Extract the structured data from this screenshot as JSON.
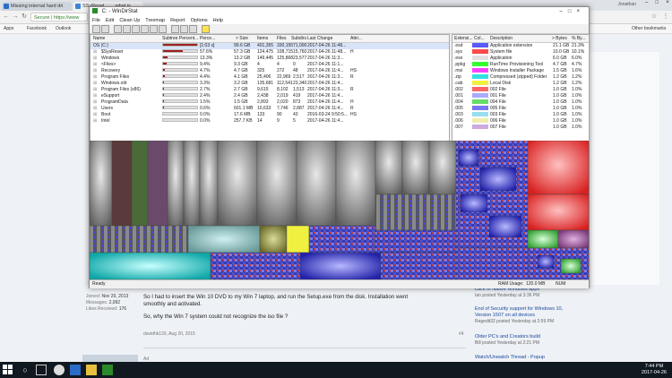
{
  "browser": {
    "tabs": [
      {
        "label": "Missing internal hard dri",
        "color": "#2b6cc8",
        "active": false
      },
      {
        "label": "SSyReset........what is",
        "color": "#3a86d8",
        "active": true
      },
      {
        "label": "",
        "color": "#cfd5dc",
        "active": false
      }
    ],
    "account_label": "Jonathan",
    "address": "Secure | https://www",
    "bookmarks": [
      "Apps",
      "Facebook",
      "Outlook"
    ],
    "other_bookmarks": "Other bookmarks"
  },
  "wds": {
    "title": "C: - WinDirStat",
    "menu": [
      "File",
      "Edit",
      "Clean Up",
      "Treemap",
      "Report",
      "Options",
      "Help"
    ],
    "columns": [
      "Name",
      "Subtree Percent...",
      "Perce...",
      "> Size",
      "Items",
      "Files",
      "Subdirs",
      "Last Change",
      "Attri..."
    ],
    "rows": [
      {
        "name": "OS (C:)",
        "pct": "[1:03 s]",
        "size": "99.6 GB",
        "items": "401,355",
        "files": "330,155",
        "subdirs": "71,000",
        "changed": "2017-04-26 11:48...",
        "attr": "",
        "fill": 0.99,
        "sel": true
      },
      {
        "name": "$SysReset",
        "pct": "57.6%",
        "size": "57.3 GB",
        "items": "124,475",
        "files": "108,715",
        "subdirs": "15,760",
        "changed": "2017-04-26 11:48...",
        "attr": "H",
        "fill": 0.576
      },
      {
        "name": "Windows",
        "pct": "13.3%",
        "size": "13.2 GB",
        "items": "149,445",
        "files": "125,868",
        "subdirs": "23,577",
        "changed": "2017-04-26 11:3...",
        "attr": "",
        "fill": 0.133
      },
      {
        "name": "<Files>",
        "pct": "9.4%",
        "size": "9.3 GB",
        "items": "4",
        "files": "4",
        "subdirs": "0",
        "changed": "2017-04-26 11:1...",
        "attr": "",
        "fill": 0.094
      },
      {
        "name": "Recovery",
        "pct": "4.7%",
        "size": "4.7 GB",
        "items": "325",
        "files": "272",
        "subdirs": "48",
        "changed": "2017-04-26 11:4...",
        "attr": "HS",
        "fill": 0.047
      },
      {
        "name": "Program Files",
        "pct": "4.4%",
        "size": "4.1 GB",
        "items": "25,406",
        "files": "22,969",
        "subdirs": "2,517",
        "changed": "2017-04-26 11:3...",
        "attr": "R",
        "fill": 0.044
      },
      {
        "name": "Windows.old",
        "pct": "3.3%",
        "size": "3.2 GB",
        "items": "135,681",
        "files": "112,541",
        "subdirs": "23,340",
        "changed": "2017-04-26 11:4...",
        "attr": "",
        "fill": 0.033
      },
      {
        "name": "Program Files (x86)",
        "pct": "2.7%",
        "size": "2.7 GB",
        "items": "9,615",
        "files": "8,102",
        "subdirs": "1,513",
        "changed": "2017-04-26 11:3...",
        "attr": "R",
        "fill": 0.027
      },
      {
        "name": "eSupport",
        "pct": "2.4%",
        "size": "2.4 GB",
        "items": "2,438",
        "files": "2,019",
        "subdirs": "419",
        "changed": "2017-04-26 11:4...",
        "attr": "",
        "fill": 0.024
      },
      {
        "name": "ProgramData",
        "pct": "1.5%",
        "size": "1.5 GB",
        "items": "2,893",
        "files": "2,020",
        "subdirs": "873",
        "changed": "2017-04-26 11:4...",
        "attr": "H",
        "fill": 0.015
      },
      {
        "name": "Users",
        "pct": "0.6%",
        "size": "601.1 MB",
        "items": "10,633",
        "files": "7,746",
        "subdirs": "2,887",
        "changed": "2017-04-26 11:4...",
        "attr": "R",
        "fill": 0.006
      },
      {
        "name": "Boot",
        "pct": "0.0%",
        "size": "17.6 MB",
        "items": "133",
        "files": "90",
        "subdirs": "43",
        "changed": "2016-03-24 9:50:5...",
        "attr": "HS",
        "fill": 0.0
      },
      {
        "name": "Intel",
        "pct": "0.0%",
        "size": "257.7 KB",
        "items": "14",
        "files": "9",
        "subdirs": "5",
        "changed": "2017-04-26 11:4...",
        "attr": "",
        "fill": 0.0
      }
    ],
    "ext_columns": [
      "Extensi...",
      "Col...",
      "Description",
      "> Bytes",
      "% By..."
    ],
    "extensions": [
      {
        "ext": ".esd",
        "color": "#5a5aff",
        "desc": "Application extension",
        "bytes": "21.1 GB",
        "pct": "21.3%"
      },
      {
        "ext": ".sys",
        "color": "#ff4a4a",
        "desc": "System file",
        "bytes": "10.0 GB",
        "pct": "10.1%"
      },
      {
        "ext": ".exe",
        "color": "#e0e0e0",
        "desc": "Application",
        "bytes": "6.0 GB",
        "pct": "6.0%"
      },
      {
        "ext": ".ppkg",
        "color": "#33ff33",
        "desc": "RunTime Provisioning Tool",
        "bytes": "4.7 GB",
        "pct": "4.7%"
      },
      {
        "ext": ".msi",
        "color": "#ff44ff",
        "desc": "Windows Installer Package",
        "bytes": "1.5 GB",
        "pct": "1.6%"
      },
      {
        "ext": ".zip",
        "color": "#33e0e0",
        "desc": "Compressed (zipped) Folder",
        "bytes": "1.2 GB",
        "pct": "1.2%"
      },
      {
        "ext": ".cab",
        "color": "#f0f040",
        "desc": "Local Disk",
        "bytes": "1.2 GB",
        "pct": "1.2%"
      },
      {
        "ext": ".002",
        "color": "#ff6666",
        "desc": "002 File",
        "bytes": "1.0 GB",
        "pct": "1.0%"
      },
      {
        "ext": ".001",
        "color": "#aaaaff",
        "desc": "001 File",
        "bytes": "1.0 GB",
        "pct": "1.0%"
      },
      {
        "ext": ".004",
        "color": "#66dd66",
        "desc": "004 File",
        "bytes": "1.0 GB",
        "pct": "1.0%"
      },
      {
        "ext": ".005",
        "color": "#7777ee",
        "desc": "005 File",
        "bytes": "1.0 GB",
        "pct": "1.0%"
      },
      {
        "ext": ".003",
        "color": "#99ddee",
        "desc": "003 File",
        "bytes": "1.0 GB",
        "pct": "1.0%"
      },
      {
        "ext": ".006",
        "color": "#eeeeaa",
        "desc": "006 File",
        "bytes": "1.0 GB",
        "pct": "1.0%"
      },
      {
        "ext": ".007",
        "color": "#ccaadd",
        "desc": "007 File",
        "bytes": "1.0 GB",
        "pct": "1.0%"
      }
    ],
    "status_left": "Ready",
    "status_ram": "RAM Usage:",
    "status_ram_value": "120.0 MB",
    "status_num": "NUM"
  },
  "post": {
    "joined_label": "Joined:",
    "joined": "Nov 20, 2013",
    "messages_label": "Messages:",
    "messages": "2,092",
    "likes_label": "Likes Received:",
    "likes": "176",
    "line1": "So I had to insert the Win 10 DVD to my Win 7 laptop, and run the Setup.exe from the disk. Installation went",
    "line2": "smoothly and activated.",
    "line3": "So, why the Win 7 system could not recognize the iso file ?",
    "author_date": "davidhk129, Aug 20, 2015",
    "post_num": "#4",
    "ad_label": "Ad"
  },
  "sidebar": [
    {
      "title": "Lack of Native Windows apps",
      "meta": "Ian posted Yesterday at 3:36 PM"
    },
    {
      "title": "End of Security support for Windows 10, Version 1507 on all devices",
      "meta": "Regedit32 posted Yesterday at 2:59 PM"
    },
    {
      "title": "Older PC's and Creators build",
      "meta": "Bill posted Yesterday at 2:21 PM"
    },
    {
      "title": "Watch/Unwatch Thread - Popup",
      "meta": ""
    }
  ],
  "taskbar": {
    "time": "7:44 PM",
    "date": "2017-04-26"
  }
}
